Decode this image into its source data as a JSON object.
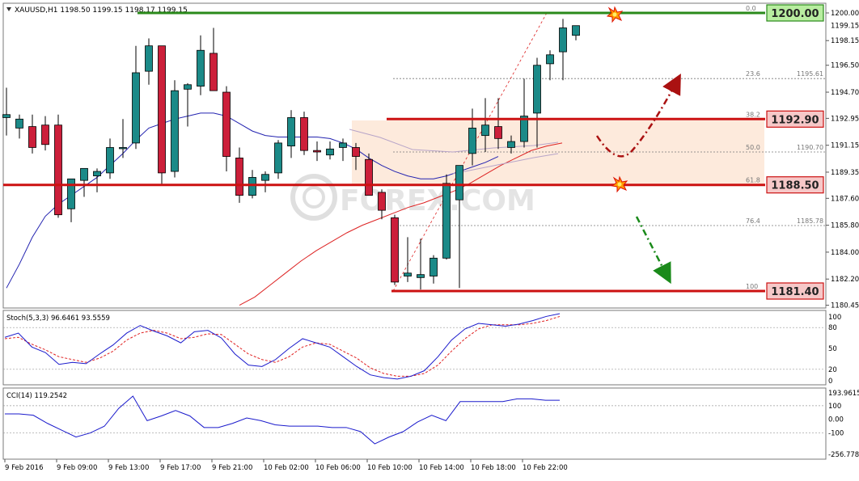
{
  "colors": {
    "bull": "#1b8a88",
    "bear": "#cc1f3a",
    "ma_fast": "#2323b0",
    "ma_slow": "#dd2222",
    "stoch_main": "#1a1acc",
    "stoch_signal": "#e02020",
    "cci": "#1a1acc",
    "level_red": "#cc1111",
    "level_green": "#2a8a1a",
    "label_red_bg": "#f6c8c8",
    "label_green_bg": "#b8eda0",
    "zone": "#fde6d6",
    "arrow_up": "#aa1111",
    "arrow_down": "#1a8a1a",
    "burst": "#ee3311"
  },
  "chart_header": "XAUUSD,H1  1198.50 1199.15 1198.17 1199.15",
  "price_axis_ticks": [
    "1200.00",
    "1198.15",
    "1196.50",
    "1194.70",
    "1192.95",
    "1191.15",
    "1189.35",
    "1187.60",
    "1185.80",
    "1184.00",
    "1182.20",
    "1180.45"
  ],
  "price_current_label": "1199.15",
  "levels": [
    {
      "name": "resistance-1200",
      "price": 1200.0,
      "label": "1200.00",
      "kind": "green"
    },
    {
      "name": "resistance-1192",
      "price": 1192.9,
      "label": "1192.90",
      "kind": "red"
    },
    {
      "name": "pivot-1188",
      "price": 1188.5,
      "label": "1188.50",
      "kind": "red"
    },
    {
      "name": "support-1181",
      "price": 1181.4,
      "label": "1181.40",
      "kind": "red"
    }
  ],
  "fib_levels": [
    {
      "pct": "0.0",
      "price": 1200.0,
      "value_text": ""
    },
    {
      "pct": "23.6",
      "price": 1195.61,
      "value_text": "1195.61"
    },
    {
      "pct": "38.2",
      "price": 1192.9,
      "value_text": ""
    },
    {
      "pct": "50.0",
      "price": 1190.7,
      "value_text": "1190.70"
    },
    {
      "pct": "61.8",
      "price": 1188.5,
      "value_text": ""
    },
    {
      "pct": "76.4",
      "price": 1185.78,
      "value_text": "1185.78"
    },
    {
      "pct": "100",
      "price": 1181.4,
      "value_text": ""
    }
  ],
  "watermark": "FOREX.COM",
  "stoch": {
    "label": "Stoch(5,3,3) 96.6461 93.5559",
    "ticks": [
      "100",
      "80",
      "50",
      "20",
      "0"
    ],
    "main": [
      66,
      72,
      52,
      44,
      27,
      30,
      28,
      42,
      55,
      72,
      83,
      75,
      68,
      58,
      74,
      76,
      65,
      42,
      26,
      24,
      34,
      50,
      64,
      58,
      52,
      38,
      24,
      12,
      8,
      6,
      10,
      18,
      38,
      62,
      78,
      86,
      84,
      82,
      85,
      90,
      96,
      100
    ],
    "signal": [
      64,
      66,
      56,
      48,
      38,
      34,
      30,
      36,
      46,
      62,
      72,
      76,
      72,
      64,
      66,
      71,
      70,
      56,
      42,
      34,
      30,
      38,
      52,
      58,
      56,
      46,
      36,
      22,
      14,
      10,
      10,
      14,
      26,
      46,
      64,
      78,
      84,
      84,
      84,
      86,
      90,
      96
    ]
  },
  "cci": {
    "label": "CCI(14) 119.2542",
    "ticks": [
      "193.9615",
      "100",
      "0.00",
      "-100",
      "-256.7782"
    ],
    "values": [
      40,
      40,
      30,
      -30,
      -80,
      -130,
      -100,
      -50,
      80,
      170,
      -10,
      25,
      65,
      25,
      -60,
      -60,
      -30,
      10,
      -10,
      -40,
      -50,
      -50,
      -50,
      -60,
      -60,
      -90,
      -180,
      -130,
      -90,
      -20,
      30,
      -10,
      130,
      130,
      130,
      130,
      150,
      150,
      140,
      140
    ]
  },
  "time_labels": [
    "9 Feb 2016",
    "9 Feb 09:00",
    "9 Feb 13:00",
    "9 Feb 17:00",
    "9 Feb 21:00",
    "10 Feb 02:00",
    "10 Feb 06:00",
    "10 Feb 10:00",
    "10 Feb 14:00",
    "10 Feb 18:00",
    "10 Feb 22:00"
  ]
}
